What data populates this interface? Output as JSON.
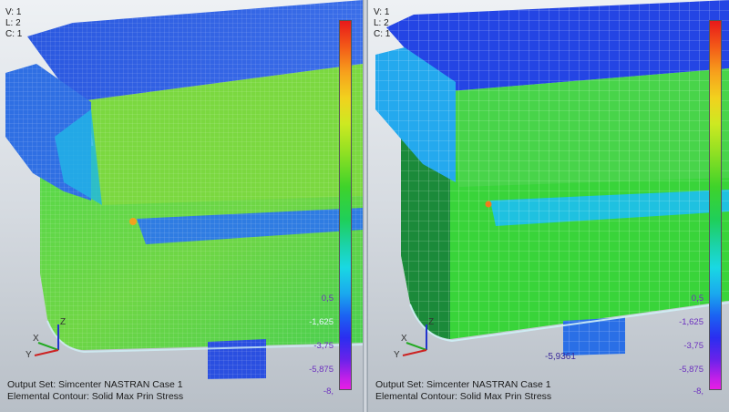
{
  "views": [
    {
      "id": "left",
      "view_info": [
        "V: 1",
        "L: 2",
        "C: 1"
      ],
      "output_set": "Output Set: Simcenter NASTRAN Case 1",
      "contour": "Elemental Contour: Solid Max Prin Stress",
      "legend_labels": [
        "",
        "",
        "",
        "",
        "",
        "",
        "",
        "",
        "",
        "",
        "0,5",
        "-1,625",
        "-3,75",
        "-5,875",
        "-8,"
      ],
      "value_tag": ""
    },
    {
      "id": "right",
      "view_info": [
        "V: 1",
        "L: 2",
        "C: 1"
      ],
      "output_set": "Output Set: Simcenter NASTRAN Case 1",
      "contour": "Elemental Contour: Solid Max Prin Stress",
      "legend_labels": [
        "",
        "",
        "",
        "",
        "",
        "",
        "",
        "",
        "",
        "",
        "0,5",
        "-1,625",
        "-3,75",
        "-5,875",
        "-8,"
      ],
      "value_tag": "-5,9361"
    }
  ],
  "axis": {
    "x": "X",
    "y": "Y",
    "z": "Z"
  },
  "colors": {
    "low": "#e81ee6",
    "mid": "#3fd32a",
    "high": "#e8191a",
    "background": "#d6dbe1"
  }
}
